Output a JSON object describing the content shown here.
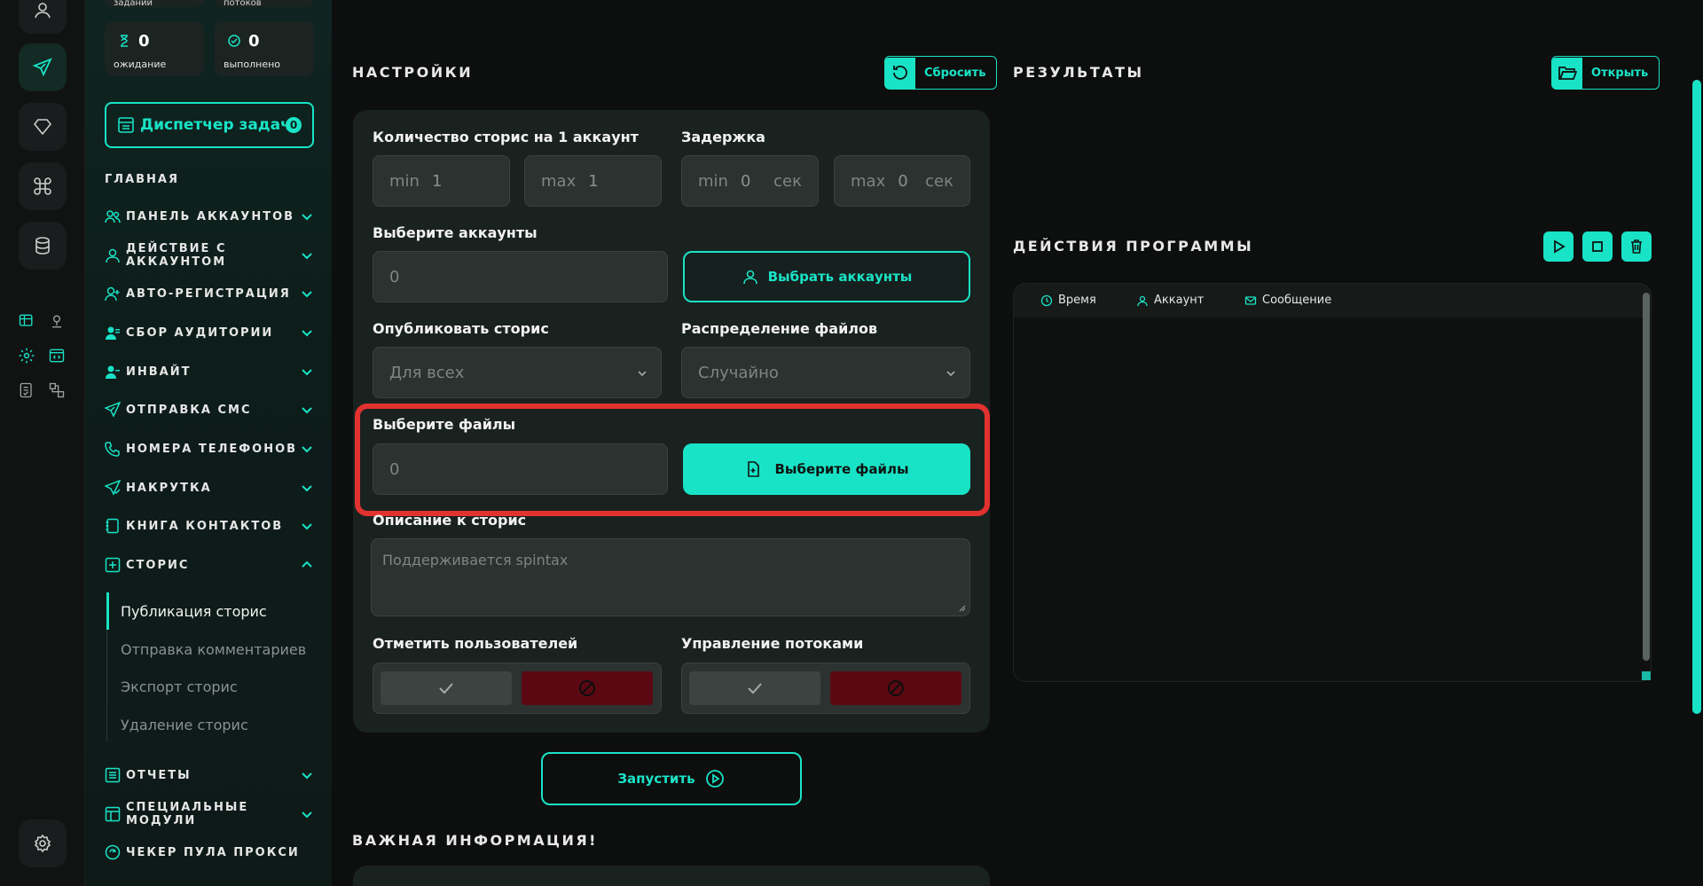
{
  "sidebar": {
    "top_cut": [
      {
        "label": "заданий"
      },
      {
        "label": "потоков"
      }
    ],
    "stats": [
      {
        "value": "0",
        "label": "ожидание",
        "icon": "hourglass-icon"
      },
      {
        "value": "0",
        "label": "выполнено",
        "icon": "check-circle-icon"
      }
    ],
    "task_manager": {
      "label": "Диспетчер задач",
      "badge": "0"
    },
    "section_title": "ГЛАВНАЯ",
    "nav": [
      {
        "label": "ПАНЕЛЬ АККАУНТОВ",
        "icon": "users-icon"
      },
      {
        "label": "ДЕЙСТВИЕ С АККАУНТОМ",
        "icon": "user-icon"
      },
      {
        "label": "АВТО-РЕГИСТРАЦИЯ",
        "icon": "user-plus-icon"
      },
      {
        "label": "СБОР АУДИТОРИИ",
        "icon": "user-group-icon"
      },
      {
        "label": "ИНВАЙТ",
        "icon": "user-invite-icon"
      },
      {
        "label": "ОТПРАВКА СМС",
        "icon": "send-icon"
      },
      {
        "label": "НОМЕРА ТЕЛЕФОНОВ",
        "icon": "phone-icon"
      },
      {
        "label": "НАКРУТКА",
        "icon": "send-check-icon"
      },
      {
        "label": "КНИГА КОНТАКТОВ",
        "icon": "book-icon"
      },
      {
        "label": "СТОРИС",
        "icon": "plus-square-icon"
      }
    ],
    "stories_sub": [
      {
        "label": "Публикация сторис"
      },
      {
        "label": "Отправка комментариев"
      },
      {
        "label": "Экспорт сторис"
      },
      {
        "label": "Удаление сторис"
      }
    ],
    "nav_bottom": [
      {
        "label": "ОТЧЕТЫ",
        "icon": "report-icon"
      },
      {
        "label": "СПЕЦИАЛЬНЫЕ МОДУЛИ",
        "icon": "modules-icon"
      },
      {
        "label": "ЧЕКЕР ПУЛА ПРОКСИ",
        "icon": "proxy-icon"
      }
    ]
  },
  "settings": {
    "title": "НАСТРОЙКИ",
    "reset_label": "Сбросить",
    "stories_count": {
      "label": "Количество сторис на 1 аккаунт",
      "min_ph": "min",
      "min_val": "1",
      "max_ph": "max",
      "max_val": "1"
    },
    "delay": {
      "label": "Задержка",
      "min_ph": "min",
      "min_val": "0",
      "max_ph": "max",
      "max_val": "0",
      "unit": "сек"
    },
    "accounts": {
      "label": "Выберите аккаунты",
      "value": "0",
      "button": "Выбрать аккаунты"
    },
    "publish": {
      "label": "Опубликовать сторис",
      "selected": "Для всех"
    },
    "distribution": {
      "label": "Распределение файлов",
      "selected": "Случайно"
    },
    "files": {
      "label": "Выберите файлы",
      "value": "0",
      "button": "Выберите файлы"
    },
    "description": {
      "label": "Описание к сторис",
      "placeholder": "Поддерживается spintax"
    },
    "mark_users": {
      "label": "Отметить пользователей"
    },
    "threads": {
      "label": "Управление потоками"
    },
    "run_label": "Запустить"
  },
  "important": {
    "title": "ВАЖНАЯ ИНФОРМАЦИЯ!"
  },
  "results": {
    "title": "РЕЗУЛЬТАТЫ",
    "open_label": "Открыть"
  },
  "actions": {
    "title": "ДЕЙСТВИЯ ПРОГРАММЫ",
    "columns": [
      {
        "label": "Время",
        "icon": "clock-icon"
      },
      {
        "label": "Аккаунт",
        "icon": "user-icon"
      },
      {
        "label": "Сообщение",
        "icon": "mail-icon"
      }
    ]
  },
  "colors": {
    "accent": "#19e3c6",
    "highlight": "#e1322f",
    "danger": "#5c0812"
  }
}
